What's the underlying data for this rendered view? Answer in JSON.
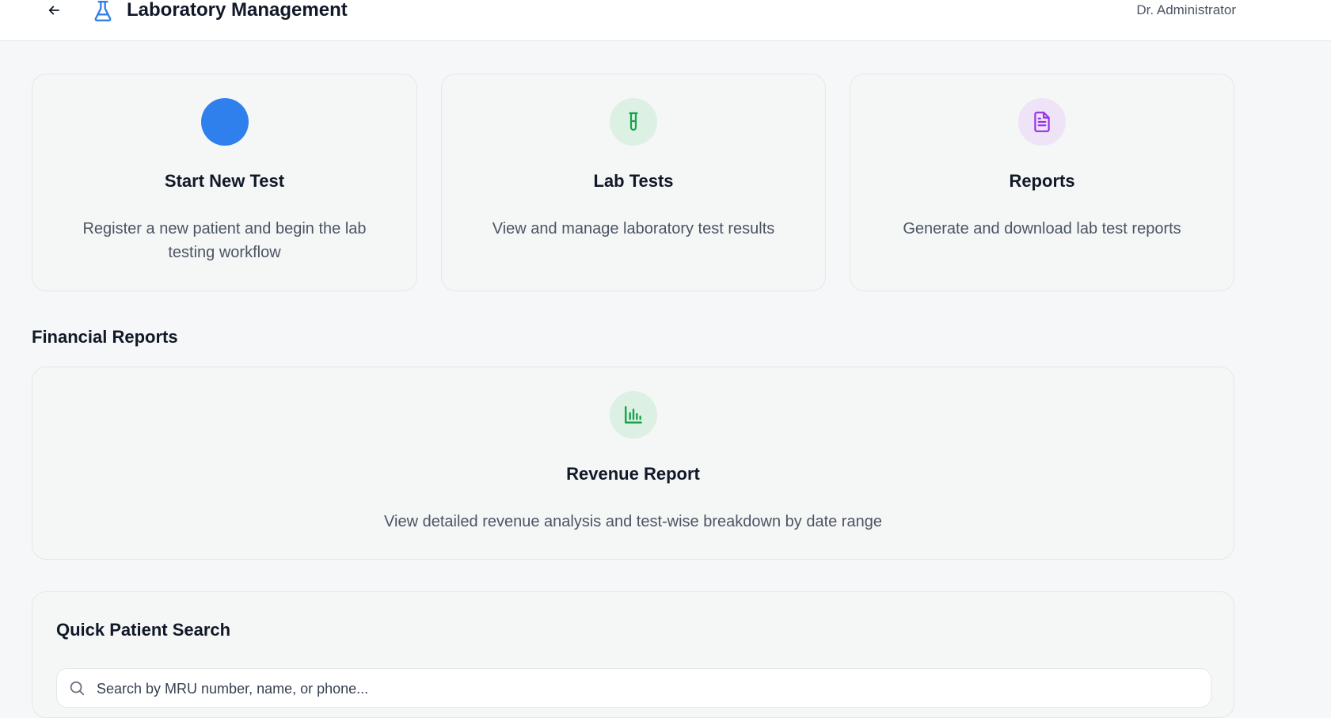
{
  "header": {
    "title": "Laboratory Management",
    "user": "Dr. Administrator"
  },
  "cards": [
    {
      "title": "Start New Test",
      "description": "Register a new patient and begin the lab testing workflow",
      "icon": "blue-circle-icon",
      "icon_color": "#2f80ed"
    },
    {
      "title": "Lab Tests",
      "description": "View and manage laboratory test results",
      "icon": "test-tube-icon",
      "icon_color": "#16a34a",
      "icon_bg": "#dcf1e3"
    },
    {
      "title": "Reports",
      "description": "Generate and download lab test reports",
      "icon": "document-icon",
      "icon_color": "#9333ea",
      "icon_bg": "#efe3f7"
    }
  ],
  "financial": {
    "section_title": "Financial Reports",
    "revenue_card": {
      "title": "Revenue Report",
      "description": "View detailed revenue analysis and test-wise breakdown by date range",
      "icon": "bar-chart-icon",
      "icon_color": "#16a34a",
      "icon_bg": "#dcf1e3"
    }
  },
  "search": {
    "title": "Quick Patient Search",
    "placeholder": "Search by MRU number, name, or phone..."
  }
}
